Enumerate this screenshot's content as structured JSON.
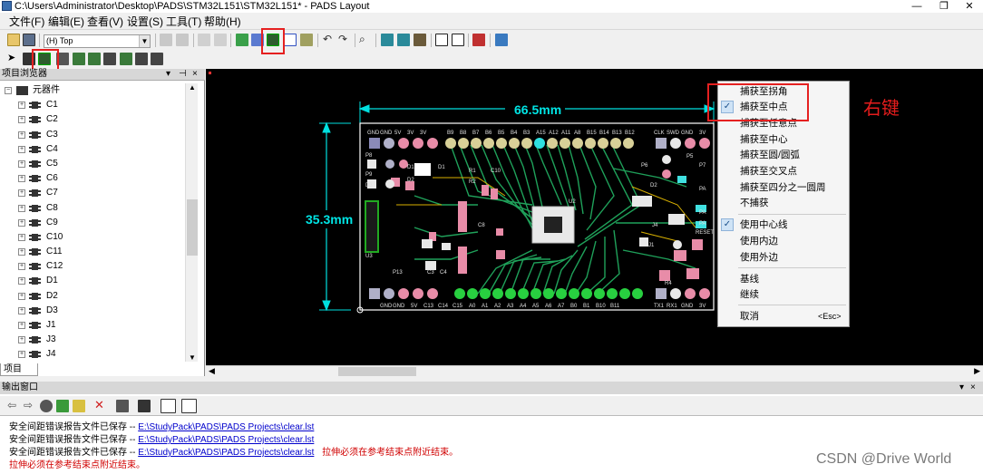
{
  "window": {
    "title": "C:\\Users\\Administrator\\Desktop\\PADS\\STM32L151\\STM32L151* - PADS Layout",
    "minimize": "—",
    "maximize": "❐",
    "close": "✕"
  },
  "menu": [
    "文件(F)",
    "编辑(E)",
    "查看(V)",
    "设置(S)",
    "工具(T)",
    "帮助(H)"
  ],
  "toolbar": {
    "layer_value": "(H) Top"
  },
  "left_panel": {
    "title": "项目浏览器",
    "pin": "📌",
    "close": "×",
    "root": "元器件",
    "items": [
      "C1",
      "C2",
      "C3",
      "C4",
      "C5",
      "C6",
      "C7",
      "C8",
      "C9",
      "C10",
      "C11",
      "C12",
      "D1",
      "D2",
      "D3",
      "J1",
      "J3",
      "J4"
    ],
    "tab": "项目"
  },
  "pcb": {
    "width_dim": "66.5mm",
    "height_dim": "35.3mm",
    "top_pins": [
      "GND",
      "GND",
      "5V",
      "3V",
      "3V",
      "B9",
      "B8",
      "B7",
      "B6",
      "B5",
      "B4",
      "B3",
      "A15",
      "A12",
      "A11",
      "A8",
      "B15",
      "B14",
      "B13",
      "B12",
      "CLK",
      "SWD",
      "GND",
      "3V"
    ],
    "bottom_pins": [
      "GND",
      "GND",
      "5V",
      "C13",
      "C14",
      "C15",
      "A0",
      "A1",
      "A2",
      "A3",
      "A4",
      "A5",
      "A6",
      "A7",
      "B0",
      "B1",
      "B10",
      "B11",
      "TX1",
      "RX1",
      "GND",
      "3V"
    ],
    "refs": [
      "P8",
      "P9",
      "D3",
      "D1",
      "D2",
      "D1",
      "R1",
      "R2",
      "C10",
      "U2",
      "P5",
      "P6",
      "P7",
      "D2",
      "PA",
      "PA",
      "J4",
      "PA",
      "RESET",
      "J1",
      "R4",
      "U3",
      "P13",
      "C3",
      "C4",
      "C8"
    ]
  },
  "context_menu": {
    "items": [
      {
        "label": "捕获至拐角",
        "checked": false
      },
      {
        "label": "捕获至中点",
        "checked": true
      },
      {
        "label": "捕获至任意点",
        "checked": false
      },
      {
        "label": "捕获至中心",
        "checked": false
      },
      {
        "label": "捕获至圆/圆弧",
        "checked": false
      },
      {
        "label": "捕获至交叉点",
        "checked": false
      },
      {
        "label": "捕获至四分之一圆周",
        "checked": false
      },
      {
        "label": "不捕获",
        "checked": false
      },
      {
        "label": "使用中心线",
        "checked": true
      },
      {
        "label": "使用内边",
        "checked": false
      },
      {
        "label": "使用外边",
        "checked": false
      },
      {
        "label": "基线",
        "checked": false
      },
      {
        "label": "继续",
        "checked": false
      },
      {
        "label": "取消",
        "checked": false,
        "shortcut": "<Esc>"
      }
    ]
  },
  "annotation": {
    "right_click": "右键"
  },
  "output_panel": {
    "title": "输出窗口",
    "lines": [
      {
        "text": "安全间距错误报告文件已保存  -- ",
        "link": "E:\\StudyPack\\PADS\\PADS Projects\\clear.lst",
        "note": ""
      },
      {
        "text": "安全间距错误报告文件已保存  -- ",
        "link": "E:\\StudyPack\\PADS\\PADS Projects\\clear.lst",
        "note": ""
      },
      {
        "text": "安全间距错误报告文件已保存  -- ",
        "link": "E:\\StudyPack\\PADS\\PADS Projects\\clear.lst",
        "note": "拉伸必须在参考结束点附近结束。"
      },
      {
        "text": "",
        "link": "",
        "note": "拉伸必须在参考结束点附近结束。"
      }
    ]
  },
  "watermark": "CSDN @Drive World",
  "colors": {
    "highlight_red": "#e52020",
    "pcb_outline": "#ffffff",
    "dimension": "#00e5e5"
  }
}
